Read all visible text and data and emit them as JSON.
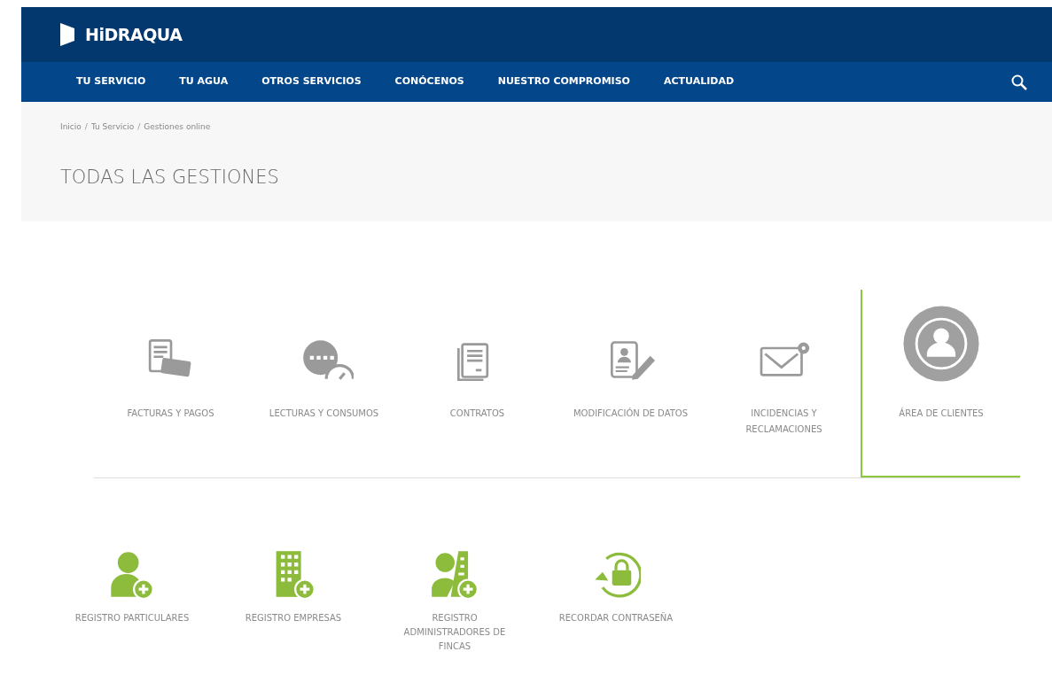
{
  "header": {
    "logo": "HiDRAQUA"
  },
  "nav": [
    "TU SERVICIO",
    "TU AGUA",
    "OTROS SERVICIOS",
    "CONÓCENOS",
    "NUESTRO COMPROMISO",
    "ACTUALIDAD"
  ],
  "breadcrumb": {
    "items": [
      "Inicio",
      "Tu Servicio",
      "Gestiones online"
    ],
    "separator": "/"
  },
  "title": "TODAS LAS GESTIONES",
  "gestiones": [
    {
      "kind": "invoice",
      "label": "FACTURAS Y PAGOS",
      "selected": false
    },
    {
      "kind": "meter",
      "label": "LECTURAS Y CONSUMOS",
      "selected": false
    },
    {
      "kind": "contract",
      "label": "CONTRATOS",
      "selected": false
    },
    {
      "kind": "profile",
      "label": "MODIFICACIÓN DE DATOS",
      "selected": false
    },
    {
      "kind": "mail",
      "label": "INCIDENCIAS Y RECLAMACIONES",
      "selected": false
    },
    {
      "kind": "user",
      "label": "ÁREA DE CLIENTES",
      "selected": true
    }
  ],
  "registros": [
    {
      "kind": "person",
      "label": "REGISTRO PARTICULARES"
    },
    {
      "kind": "building",
      "label": "REGISTRO EMPRESAS"
    },
    {
      "kind": "both",
      "label": "REGISTRO ADMINISTRADORES DE FINCAS"
    },
    {
      "kind": "lock",
      "label": "RECORDAR CONTRASEÑA"
    }
  ]
}
